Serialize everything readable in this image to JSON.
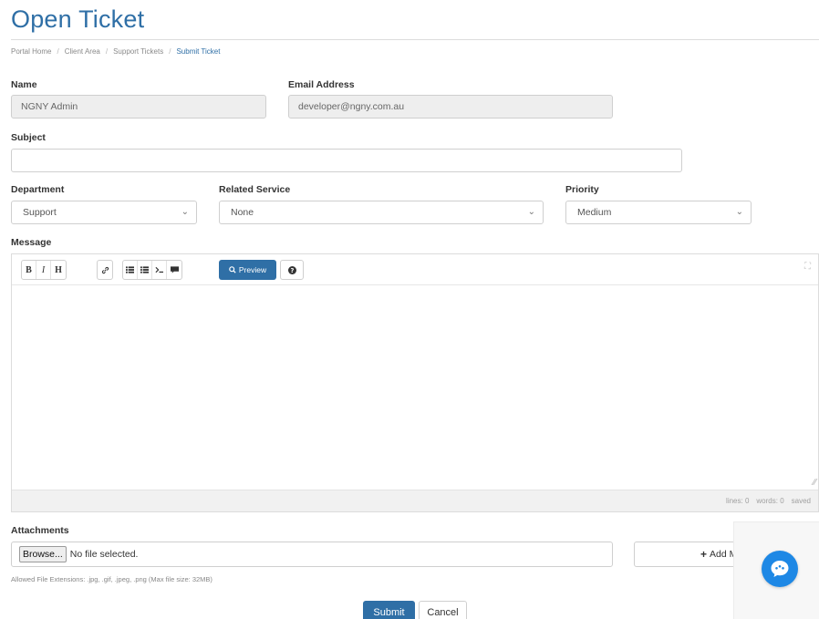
{
  "page": {
    "title": "Open Ticket"
  },
  "breadcrumb": {
    "items": [
      "Portal Home",
      "Client Area",
      "Support Tickets"
    ],
    "active": "Submit Ticket",
    "separator": "/"
  },
  "form": {
    "name_label": "Name",
    "name_value": "NGNY Admin",
    "email_label": "Email Address",
    "email_value": "developer@ngny.com.au",
    "subject_label": "Subject",
    "subject_value": "",
    "department_label": "Department",
    "department_value": "Support",
    "related_service_label": "Related Service",
    "related_service_value": "None",
    "priority_label": "Priority",
    "priority_value": "Medium",
    "message_label": "Message"
  },
  "editor": {
    "toolbar": {
      "bold": "B",
      "italic": "I",
      "heading": "H",
      "link_icon": "link-icon",
      "unordered_list_icon": "list-ul-icon",
      "ordered_list_icon": "list-ol-icon",
      "code_icon": "terminal-icon",
      "quote_icon": "comment-icon",
      "preview_label": "Preview",
      "help_icon": "question-circle-icon",
      "fullscreen_icon": "expand-icon"
    },
    "status": {
      "lines": "lines: 0",
      "words": "words: 0",
      "saved": "saved"
    }
  },
  "attachments": {
    "label": "Attachments",
    "browse_label": "Browse...",
    "file_status": "No file selected.",
    "add_more_label": "Add M",
    "hint": "Allowed File Extensions: .jpg, .gif, .jpeg, .png (Max file size: 32MB)"
  },
  "actions": {
    "submit_label": "Submit",
    "cancel_label": "Cancel"
  },
  "chat_widget": {
    "icon": "chat-bubble-icon",
    "color": "#1e88e5"
  },
  "colors": {
    "accent": "#2f6fa6"
  }
}
